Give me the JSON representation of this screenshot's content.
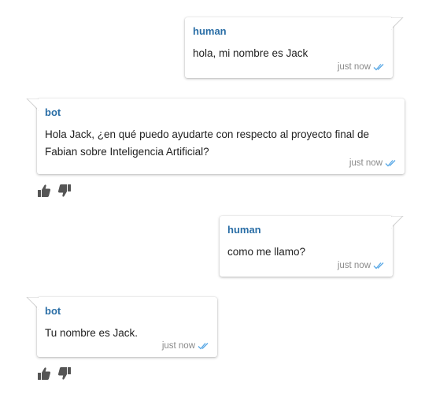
{
  "messages": [
    {
      "role": "human",
      "author": "human",
      "text": "hola, mi nombre es Jack",
      "time": "just now"
    },
    {
      "role": "bot",
      "author": "bot",
      "text": "Hola Jack, ¿en qué puedo ayudarte con respecto al proyecto final de Fabian sobre Inteligencia Artificial?",
      "time": "just now"
    },
    {
      "role": "human",
      "author": "human",
      "text": "como me llamo?",
      "time": "just now"
    },
    {
      "role": "bot",
      "author": "bot",
      "text": "Tu nombre es Jack.",
      "time": "just now"
    }
  ],
  "icons": {
    "read_receipt": "double-check-icon",
    "like": "thumbs-up-icon",
    "dislike": "thumbs-down-icon"
  },
  "colors": {
    "author": "#2a6ea6",
    "read_receipt": "#5aa9e6",
    "feedback_icon": "#555555"
  }
}
